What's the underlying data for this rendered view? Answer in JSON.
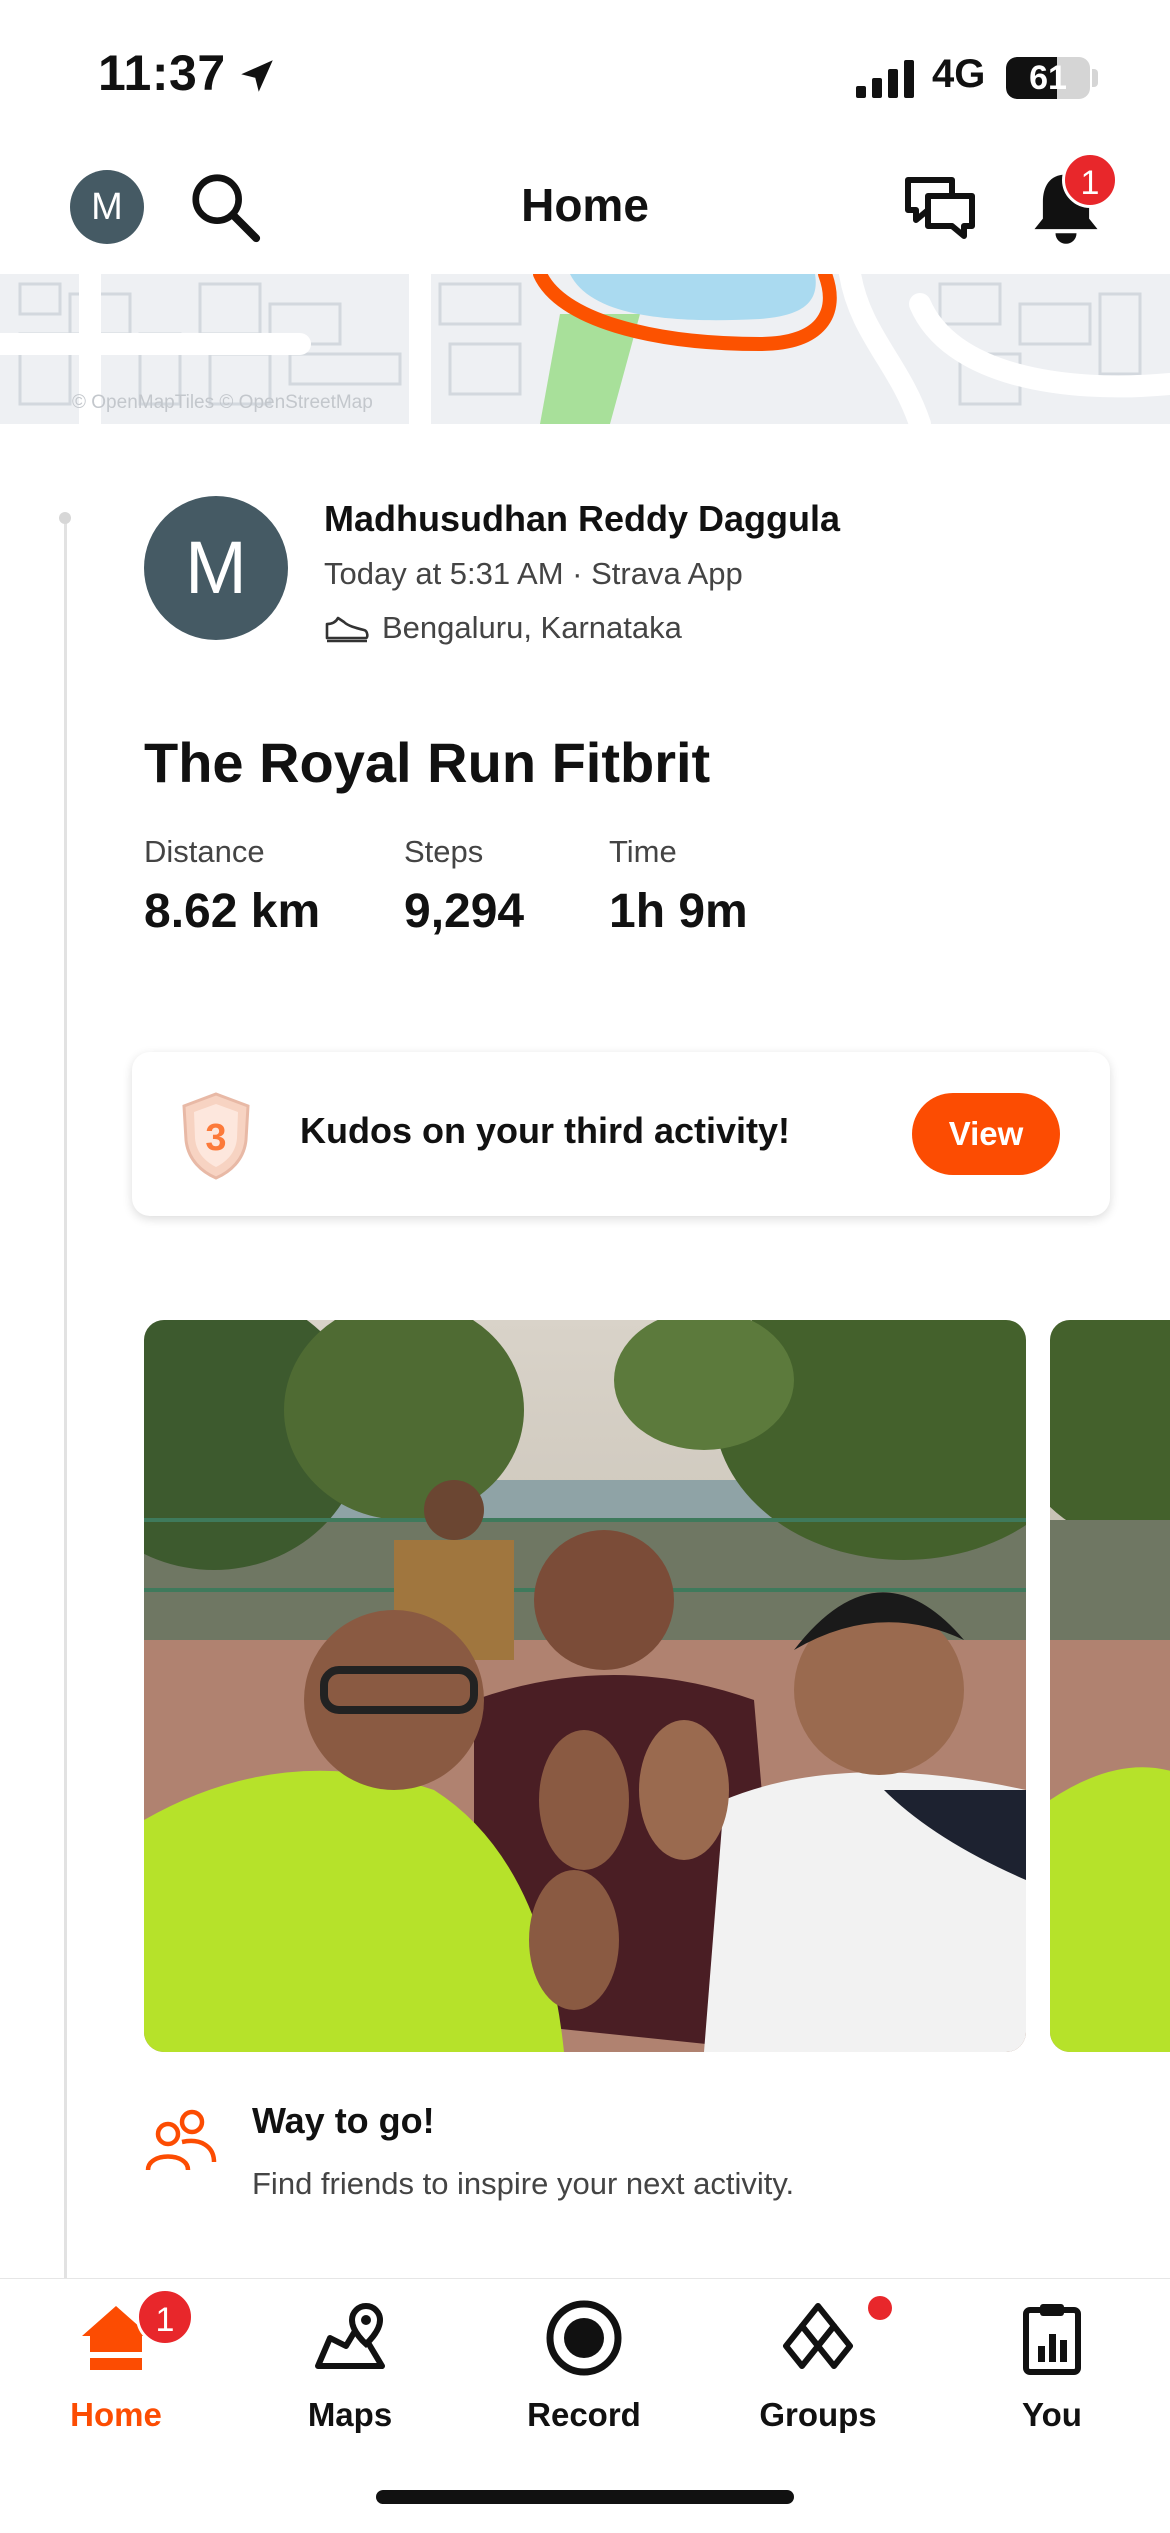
{
  "status_bar": {
    "time": "11:37",
    "network": "4G",
    "battery_text": "61",
    "battery_level": 0.61,
    "location_icon": "location-arrow-icon",
    "signal_icon": "cellular-signal-icon"
  },
  "header": {
    "avatar_initial": "M",
    "title": "Home",
    "notification_count": "1",
    "icons": [
      "search-icon",
      "chat-icon",
      "bell-icon"
    ]
  },
  "map": {
    "attribution": "© OpenMapTiles © OpenStreetMap",
    "route_color": "#fc5200"
  },
  "activity": {
    "avatar_initial": "M",
    "athlete_name": "Madhusudhan Reddy Daggula",
    "meta": "Today at 5:31 AM · Strava App",
    "location": "Bengaluru, Karnataka",
    "title": "The Royal Run Fitbrit",
    "stats": [
      {
        "label": "Distance",
        "value": "8.62 km"
      },
      {
        "label": "Steps",
        "value": "9,294"
      },
      {
        "label": "Time",
        "value": "1h 9m"
      }
    ]
  },
  "kudos_card": {
    "badge_number": "3",
    "text": "Kudos on your third activity!",
    "button_label": "View"
  },
  "way_to_go": {
    "title": "Way to go!",
    "subtitle": "Find friends to inspire your next activity."
  },
  "tabbar": {
    "tabs": [
      {
        "label": "Home",
        "icon": "home-icon"
      },
      {
        "label": "Maps",
        "icon": "maps-icon"
      },
      {
        "label": "Record",
        "icon": "record-icon"
      },
      {
        "label": "Groups",
        "icon": "groups-icon"
      },
      {
        "label": "You",
        "icon": "you-clipboard-icon"
      }
    ],
    "home_badge": "1"
  },
  "colors": {
    "brand_orange": "#fc4c02",
    "badge_red": "#e8272b",
    "avatar_slate": "#455a64"
  }
}
